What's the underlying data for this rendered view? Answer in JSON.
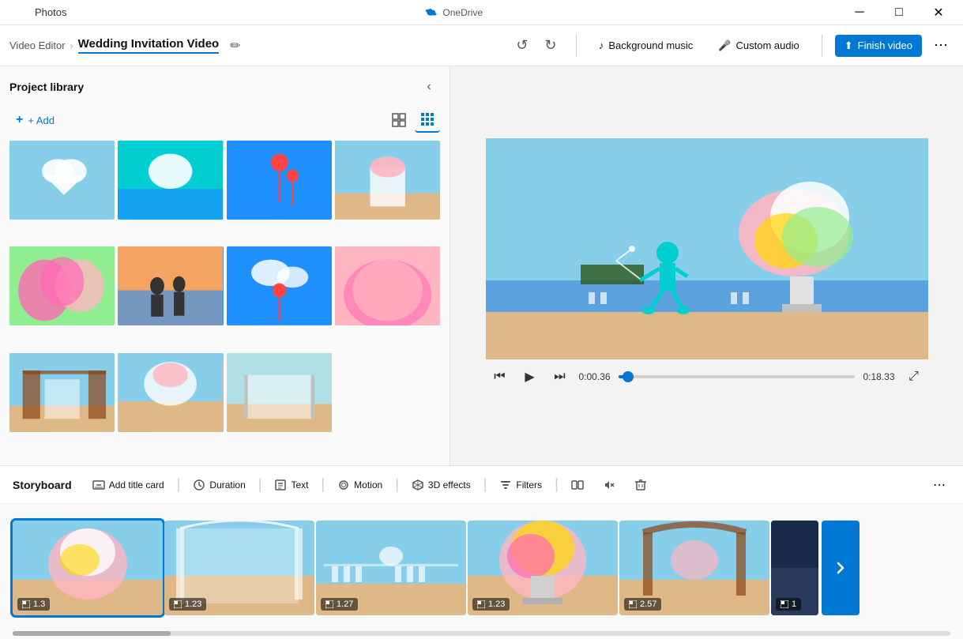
{
  "titleBar": {
    "appName": "Photos",
    "onedrive": "OneDrive",
    "minimize": "─",
    "maximize": "□",
    "close": "✕"
  },
  "appBar": {
    "backLabel": "←",
    "breadcrumb": {
      "parent": "Video Editor",
      "separator": "›",
      "current": "Wedding Invitation Video"
    },
    "editIcon": "✏",
    "undoLabel": "↺",
    "redoLabel": "↻",
    "backgroundMusic": "Background music",
    "customAudio": "Custom audio",
    "finishVideo": "Finish video",
    "more": "⋯"
  },
  "projectLibrary": {
    "title": "Project library",
    "addLabel": "+ Add",
    "collapseIcon": "‹",
    "viewGrid1Icon": "⊞",
    "viewGrid2Icon": "⊟"
  },
  "videoPlayer": {
    "skipBackIcon": "⏮",
    "playIcon": "▶",
    "skipForwardIcon": "⏭",
    "currentTime": "0:00.36",
    "totalTime": "0:18.33",
    "progress": 4,
    "fullscreenIcon": "⤢"
  },
  "storyboard": {
    "title": "Storyboard",
    "addTitleCard": "Add title card",
    "duration": "Duration",
    "text": "Text",
    "motion": "Motion",
    "threeDEffects": "3D effects",
    "filters": "Filters",
    "splitIcon": "⧉",
    "removeAudioIcon": "🔇",
    "deleteIcon": "🗑",
    "more": "⋯",
    "clips": [
      {
        "duration": "1.3",
        "color": "sc1",
        "selected": true
      },
      {
        "duration": "1.23",
        "color": "sc2",
        "selected": false
      },
      {
        "duration": "1.27",
        "color": "sc3",
        "selected": false
      },
      {
        "duration": "1.23",
        "color": "sc4",
        "selected": false
      },
      {
        "duration": "2.57",
        "color": "sc5",
        "selected": false
      },
      {
        "duration": "1",
        "color": "sc6",
        "selected": false
      }
    ]
  },
  "mediaGrid": {
    "items": [
      {
        "color": "t1"
      },
      {
        "color": "t2"
      },
      {
        "color": "t3"
      },
      {
        "color": "t4"
      },
      {
        "color": "t5"
      },
      {
        "color": "t6"
      },
      {
        "color": "t7"
      },
      {
        "color": "t8"
      },
      {
        "color": "t9"
      },
      {
        "color": "t10"
      },
      {
        "color": "t11"
      }
    ]
  }
}
